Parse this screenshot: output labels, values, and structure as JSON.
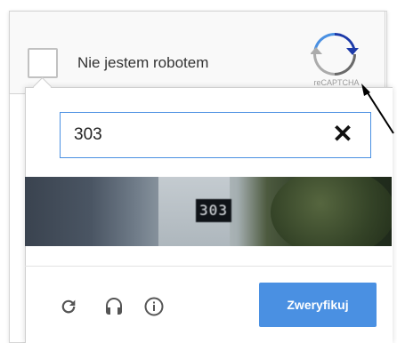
{
  "checkbox": {
    "label": "Nie jestem robotem",
    "checked": false
  },
  "recaptcha": {
    "logo_text": "reCAPTCHA"
  },
  "challenge": {
    "input_value": "303",
    "clear_symbol": "✕",
    "image_plate_text": "303"
  },
  "toolbar": {
    "reload_icon": "reload-icon",
    "audio_icon": "headphones-icon",
    "info_icon": "info-icon",
    "verify_label": "Zweryfikuj"
  },
  "colors": {
    "accent": "#4a90e2",
    "border": "#d3d3d3",
    "text": "#333333"
  }
}
